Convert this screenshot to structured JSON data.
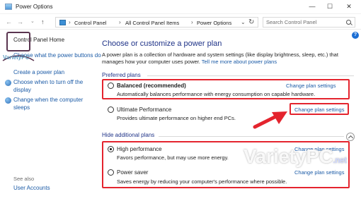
{
  "window": {
    "title": "Power Options",
    "controls": [
      "minimize",
      "maximize",
      "close"
    ]
  },
  "address": {
    "crumbs": [
      "Control Panel",
      "All Control Panel Items",
      "Power Options"
    ],
    "search_placeholder": "Search Control Panel"
  },
  "sidebar": {
    "home": "Control Panel Home",
    "items": [
      {
        "label": "Choose what the power buttons do",
        "icon": "none"
      },
      {
        "label": "Create a power plan",
        "icon": "none"
      },
      {
        "label_line1": "Choose when to turn off the",
        "label_line2": "display",
        "icon": "display-icon"
      },
      {
        "label_line1": "Change when the computer",
        "label_line2": "sleeps",
        "icon": "moon-icon"
      }
    ],
    "see_also": "See also",
    "user_accounts": "User Accounts"
  },
  "main": {
    "heading": "Choose or customize a power plan",
    "intro_line1": "A power plan is a collection of hardware and system settings (like display brightness, sleep, etc.) that",
    "intro_line2_prefix": "manages how your computer uses power.",
    "intro_link": "Tell me more about power plans",
    "preferred_section": "Preferred plans",
    "hidden_section": "Hide additional plans",
    "change_label": "Change plan settings",
    "plans": [
      {
        "name": "Balanced (recommended)",
        "desc": "Automatically balances performance with energy consumption on capable hardware.",
        "selected": false
      },
      {
        "name": "Ultimate Performance",
        "desc": "Provides ultimate performance on higher end PCs.",
        "selected": false
      },
      {
        "name": "High performance",
        "desc": "Favors performance, but may use more energy.",
        "selected": true
      },
      {
        "name": "Power saver",
        "desc": "Saves energy by reducing your computer's performance where possible.",
        "selected": false
      }
    ]
  },
  "watermark": {
    "brand": "VarietyPC",
    "tld": ".net",
    "logo_text": "VarietyPC"
  },
  "colors": {
    "link": "#1a5aa6",
    "heading": "#1e3287",
    "highlight_box": "#e4242e",
    "arrow": "#e4242e"
  }
}
